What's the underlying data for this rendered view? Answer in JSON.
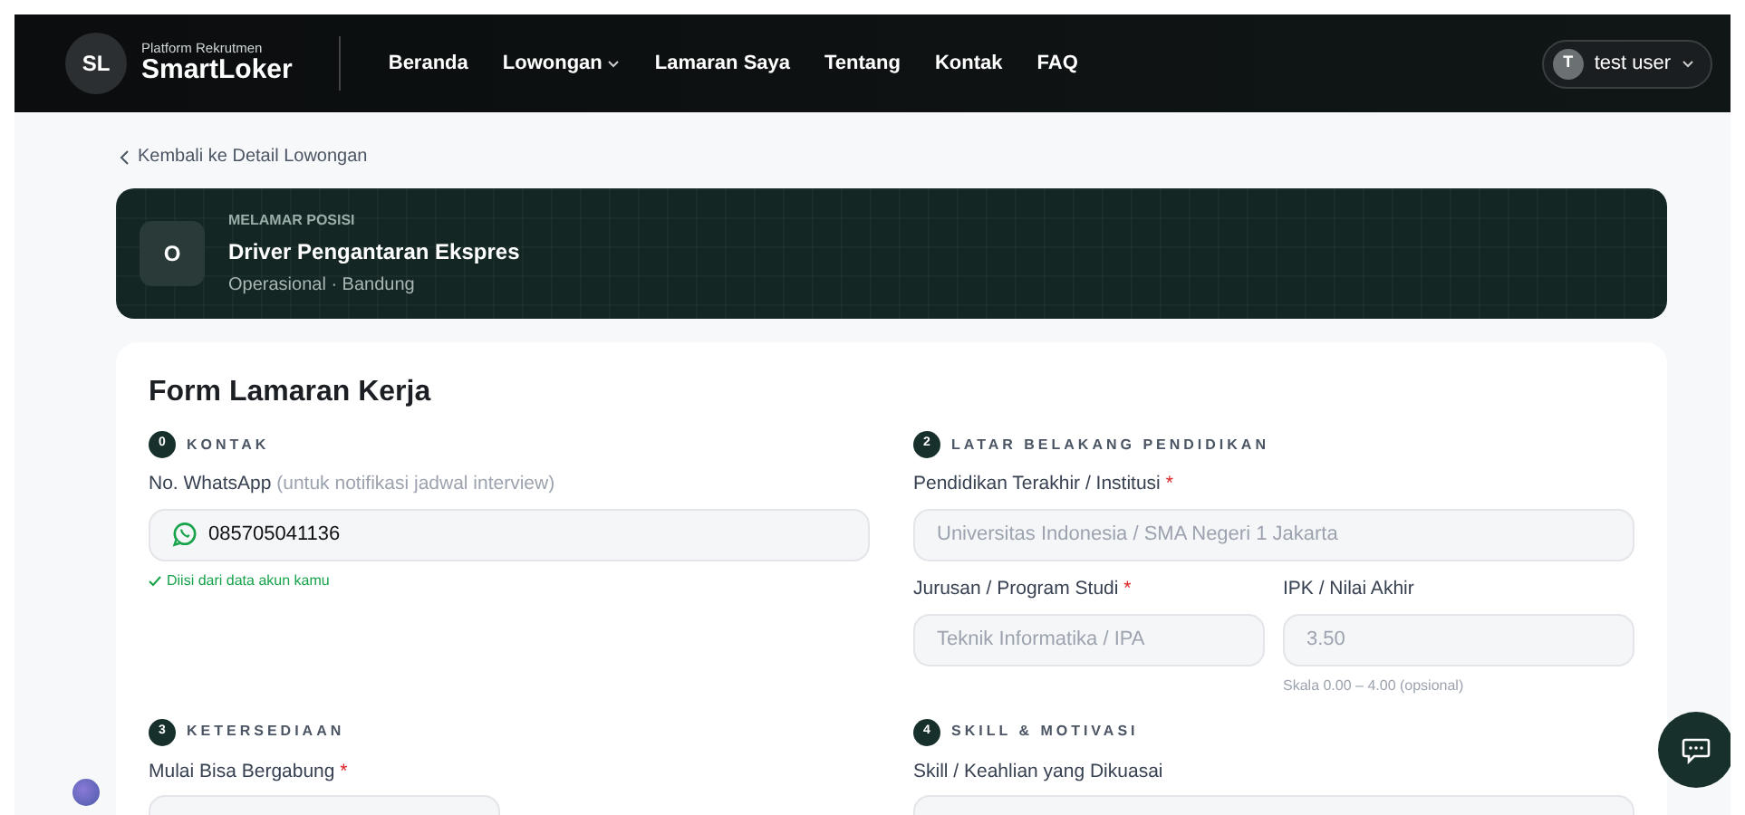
{
  "navbar": {
    "logo": "SL",
    "tagline": "Platform Rekrutmen",
    "brand": "SmartLoker",
    "items": [
      {
        "label": "Beranda",
        "dropdown": false
      },
      {
        "label": "Lowongan",
        "dropdown": true
      },
      {
        "label": "Lamaran Saya",
        "dropdown": false
      },
      {
        "label": "Tentang",
        "dropdown": false
      },
      {
        "label": "Kontak",
        "dropdown": false
      },
      {
        "label": "FAQ",
        "dropdown": false
      }
    ],
    "user": {
      "initial": "T",
      "name": "test user"
    }
  },
  "back_link": "Kembali ke Detail Lowongan",
  "position": {
    "eyebrow": "MELAMAR POSISI",
    "initial": "O",
    "title": "Driver Pengantaran Ekspres",
    "meta": "Operasional · Bandung"
  },
  "form": {
    "title": "Form Lamaran Kerja",
    "sections": [
      {
        "number": "0",
        "title": "KONTAK",
        "rows": [
          [
            {
              "kind": "phone",
              "label": "No. WhatsApp",
              "note": "(untuk notifikasi jadwal interview)",
              "value": "085705041136",
              "help": {
                "kind": "success",
                "text": "Diisi dari data akun kamu"
              }
            }
          ]
        ]
      },
      {
        "number": "2",
        "title": "LATAR BELAKANG PENDIDIKAN",
        "rows": [
          [
            {
              "kind": "text",
              "label": "Pendidikan Terakhir / Institusi",
              "required_mark": "*",
              "placeholder": "Universitas Indonesia / SMA Negeri 1 Jakarta"
            }
          ],
          [
            {
              "kind": "text",
              "label": "Jurusan / Program Studi",
              "required_mark": "*",
              "placeholder": "Teknik Informatika / IPA"
            },
            {
              "kind": "text",
              "label": "IPK / Nilai Akhir",
              "placeholder": "3.50",
              "help": {
                "kind": "note",
                "text": "Skala 0.00 – 4.00 (opsional)"
              }
            }
          ]
        ]
      },
      {
        "number": "3",
        "title": "KETERSEDIAAN",
        "rows": [
          [
            {
              "kind": "date",
              "label": "Mulai Bisa Bergabung",
              "required_mark": "*"
            }
          ]
        ]
      },
      {
        "number": "4",
        "title": "SKILL & MOTIVASI",
        "rows": [
          [
            {
              "kind": "text",
              "label": "Skill / Keahlian yang Dikuasai"
            }
          ]
        ]
      }
    ]
  }
}
